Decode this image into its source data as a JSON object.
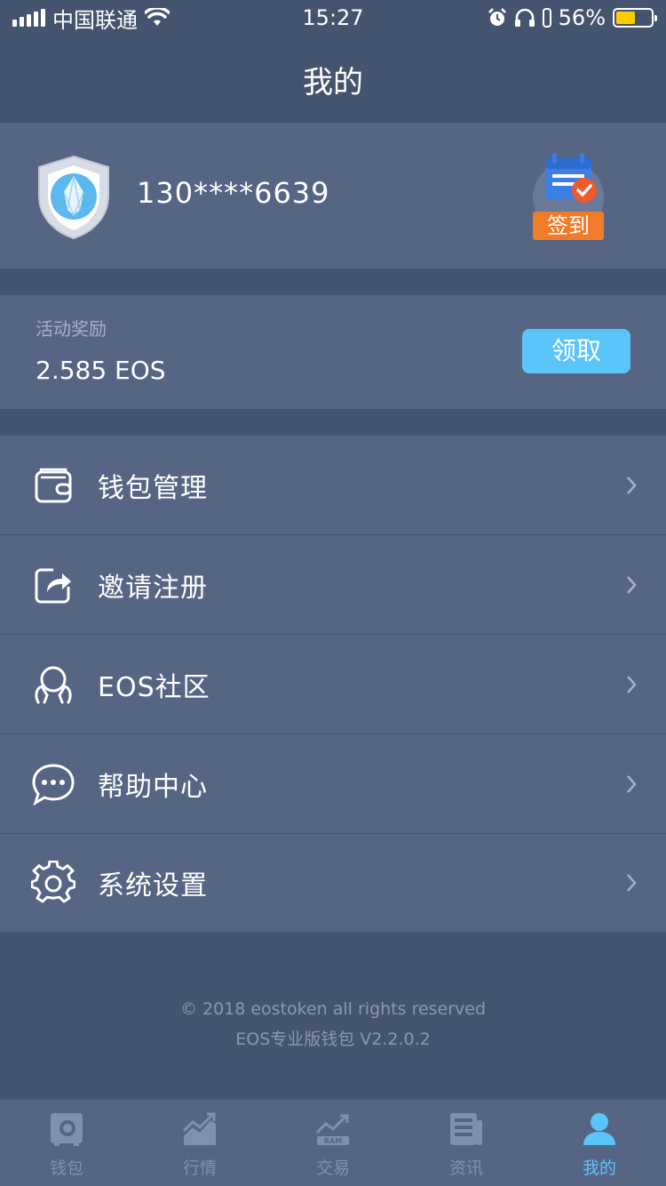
{
  "status_bar": {
    "carrier": "中国联通",
    "time": "15:27",
    "battery_percent": "56%",
    "battery_level": 0.56
  },
  "header": {
    "title": "我的"
  },
  "profile": {
    "phone": "130****6639",
    "checkin_label": "签到"
  },
  "reward": {
    "label": "活动奖励",
    "value": "2.585 EOS",
    "claim_label": "领取"
  },
  "menu": {
    "items": [
      {
        "label": "钱包管理",
        "icon": "wallet-icon"
      },
      {
        "label": "邀请注册",
        "icon": "share-icon"
      },
      {
        "label": "EOS社区",
        "icon": "community-icon"
      },
      {
        "label": "帮助中心",
        "icon": "chat-icon"
      },
      {
        "label": "系统设置",
        "icon": "gear-icon"
      }
    ]
  },
  "footer": {
    "copyright": "© 2018 eostoken all rights reserved",
    "version": "EOS专业版钱包 V2.2.0.2"
  },
  "tabbar": {
    "items": [
      {
        "label": "钱包",
        "icon": "safe-icon",
        "active": false
      },
      {
        "label": "行情",
        "icon": "market-chart-icon",
        "active": false
      },
      {
        "label": "交易",
        "icon": "ram-trade-icon",
        "active": false
      },
      {
        "label": "资讯",
        "icon": "news-icon",
        "active": false
      },
      {
        "label": "我的",
        "icon": "user-icon",
        "active": true
      }
    ]
  },
  "colors": {
    "background": "#45546e",
    "panel": "#566584",
    "accent": "#5bc5fa",
    "checkin_badge": "#f07c2a",
    "battery": "#ffcc00"
  }
}
